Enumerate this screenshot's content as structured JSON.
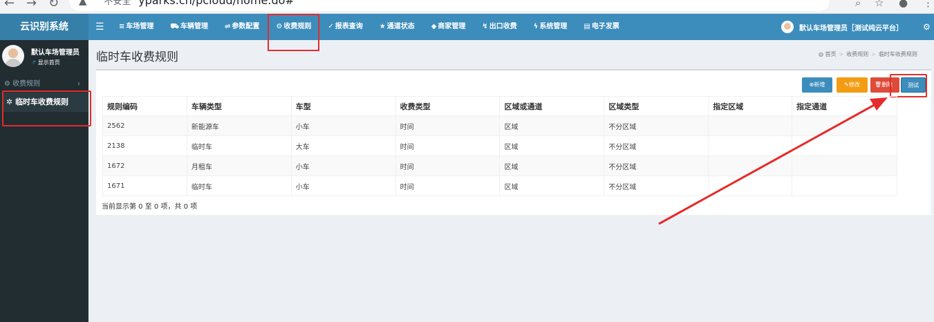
{
  "browser": {
    "security_label": "不安全",
    "url": "yparks.cn/pcloud/home.do#"
  },
  "brand": "云识别系统",
  "nav": {
    "toggle_icon": "bars-icon",
    "items": [
      {
        "icon": "≡",
        "label": "车场管理"
      },
      {
        "icon": "⛟",
        "label": "车辆管理"
      },
      {
        "icon": "⇌",
        "label": "参数配置"
      },
      {
        "icon": "⚙",
        "label": "收费规则"
      },
      {
        "icon": "✓",
        "label": "报表查询"
      },
      {
        "icon": "★",
        "label": "通道状态"
      },
      {
        "icon": "◆",
        "label": "商家管理"
      },
      {
        "icon": "↯",
        "label": "出口收费"
      },
      {
        "icon": "ϟ",
        "label": "系统管理"
      },
      {
        "icon": "▤",
        "label": "电子发票"
      }
    ],
    "highlighted_item": "收费规则",
    "user": "默认车场管理员［测试纯云平台］"
  },
  "sidebar": {
    "user_name": "默认车场管理员",
    "user_status": "显示首页",
    "section": "收费规则",
    "active_item": "临时车收费规则"
  },
  "page": {
    "title": "临时车收费规则",
    "breadcrumb": [
      "首页",
      "收费规则",
      "临时车收费规则"
    ]
  },
  "buttons": {
    "add": "新增",
    "edit": "修改",
    "delete": "删除",
    "test": "测试"
  },
  "table": {
    "columns": [
      "规则编码",
      "车辆类型",
      "车型",
      "收费类型",
      "区域或通道",
      "区域类型",
      "指定区域",
      "指定通道"
    ],
    "rows": [
      [
        "2562",
        "新能源车",
        "小车",
        "时间",
        "区域",
        "不分区域",
        "",
        ""
      ],
      [
        "2138",
        "临时车",
        "大车",
        "时间",
        "区域",
        "不分区域",
        "",
        ""
      ],
      [
        "1672",
        "月租车",
        "小车",
        "时间",
        "区域",
        "不分区域",
        "",
        ""
      ],
      [
        "1671",
        "临时车",
        "小车",
        "时间",
        "区域",
        "不分区域",
        "",
        ""
      ]
    ],
    "info": "当前显示第 0 至 0 项，共 0 项"
  },
  "colors": {
    "navbar": "#3c8dbc",
    "sidebar": "#222d32",
    "annotation": "#e52b2b"
  }
}
